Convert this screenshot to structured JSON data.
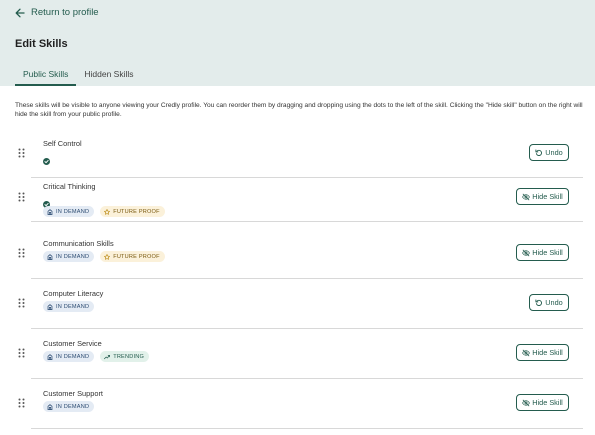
{
  "header": {
    "back_label": "Return to profile",
    "title": "Edit Skills",
    "tabs": [
      {
        "label": "Public Skills",
        "active": true
      },
      {
        "label": "Hidden Skills",
        "active": false
      }
    ]
  },
  "description": "These skills will be visible to anyone viewing your Credly profile. You can reorder them by dragging and dropping using the dots to the left of the skill. Clicking the \"Hide skill\" button on the right will hide the skill from your public profile.",
  "badge_labels": {
    "in_demand": "IN DEMAND",
    "future_proof": "FUTURE PROOF",
    "trending": "TRENDING"
  },
  "action_labels": {
    "undo": "Undo",
    "hide": "Hide Skill"
  },
  "colors": {
    "accent": "#245c4e",
    "header_bg": "#e3eceb"
  },
  "skills": [
    {
      "name": "Self Control",
      "verified": true,
      "badges": [],
      "action": "undo"
    },
    {
      "name": "Critical Thinking",
      "verified": true,
      "badges": [
        "in_demand",
        "future_proof"
      ],
      "action": "hide"
    },
    {
      "name": "Communication Skills",
      "verified": false,
      "badges": [
        "in_demand",
        "future_proof"
      ],
      "action": "hide"
    },
    {
      "name": "Computer Literacy",
      "verified": false,
      "badges": [
        "in_demand"
      ],
      "action": "undo"
    },
    {
      "name": "Customer Service",
      "verified": false,
      "badges": [
        "in_demand",
        "trending"
      ],
      "action": "hide"
    },
    {
      "name": "Customer Support",
      "verified": false,
      "badges": [
        "in_demand"
      ],
      "action": "hide"
    }
  ]
}
